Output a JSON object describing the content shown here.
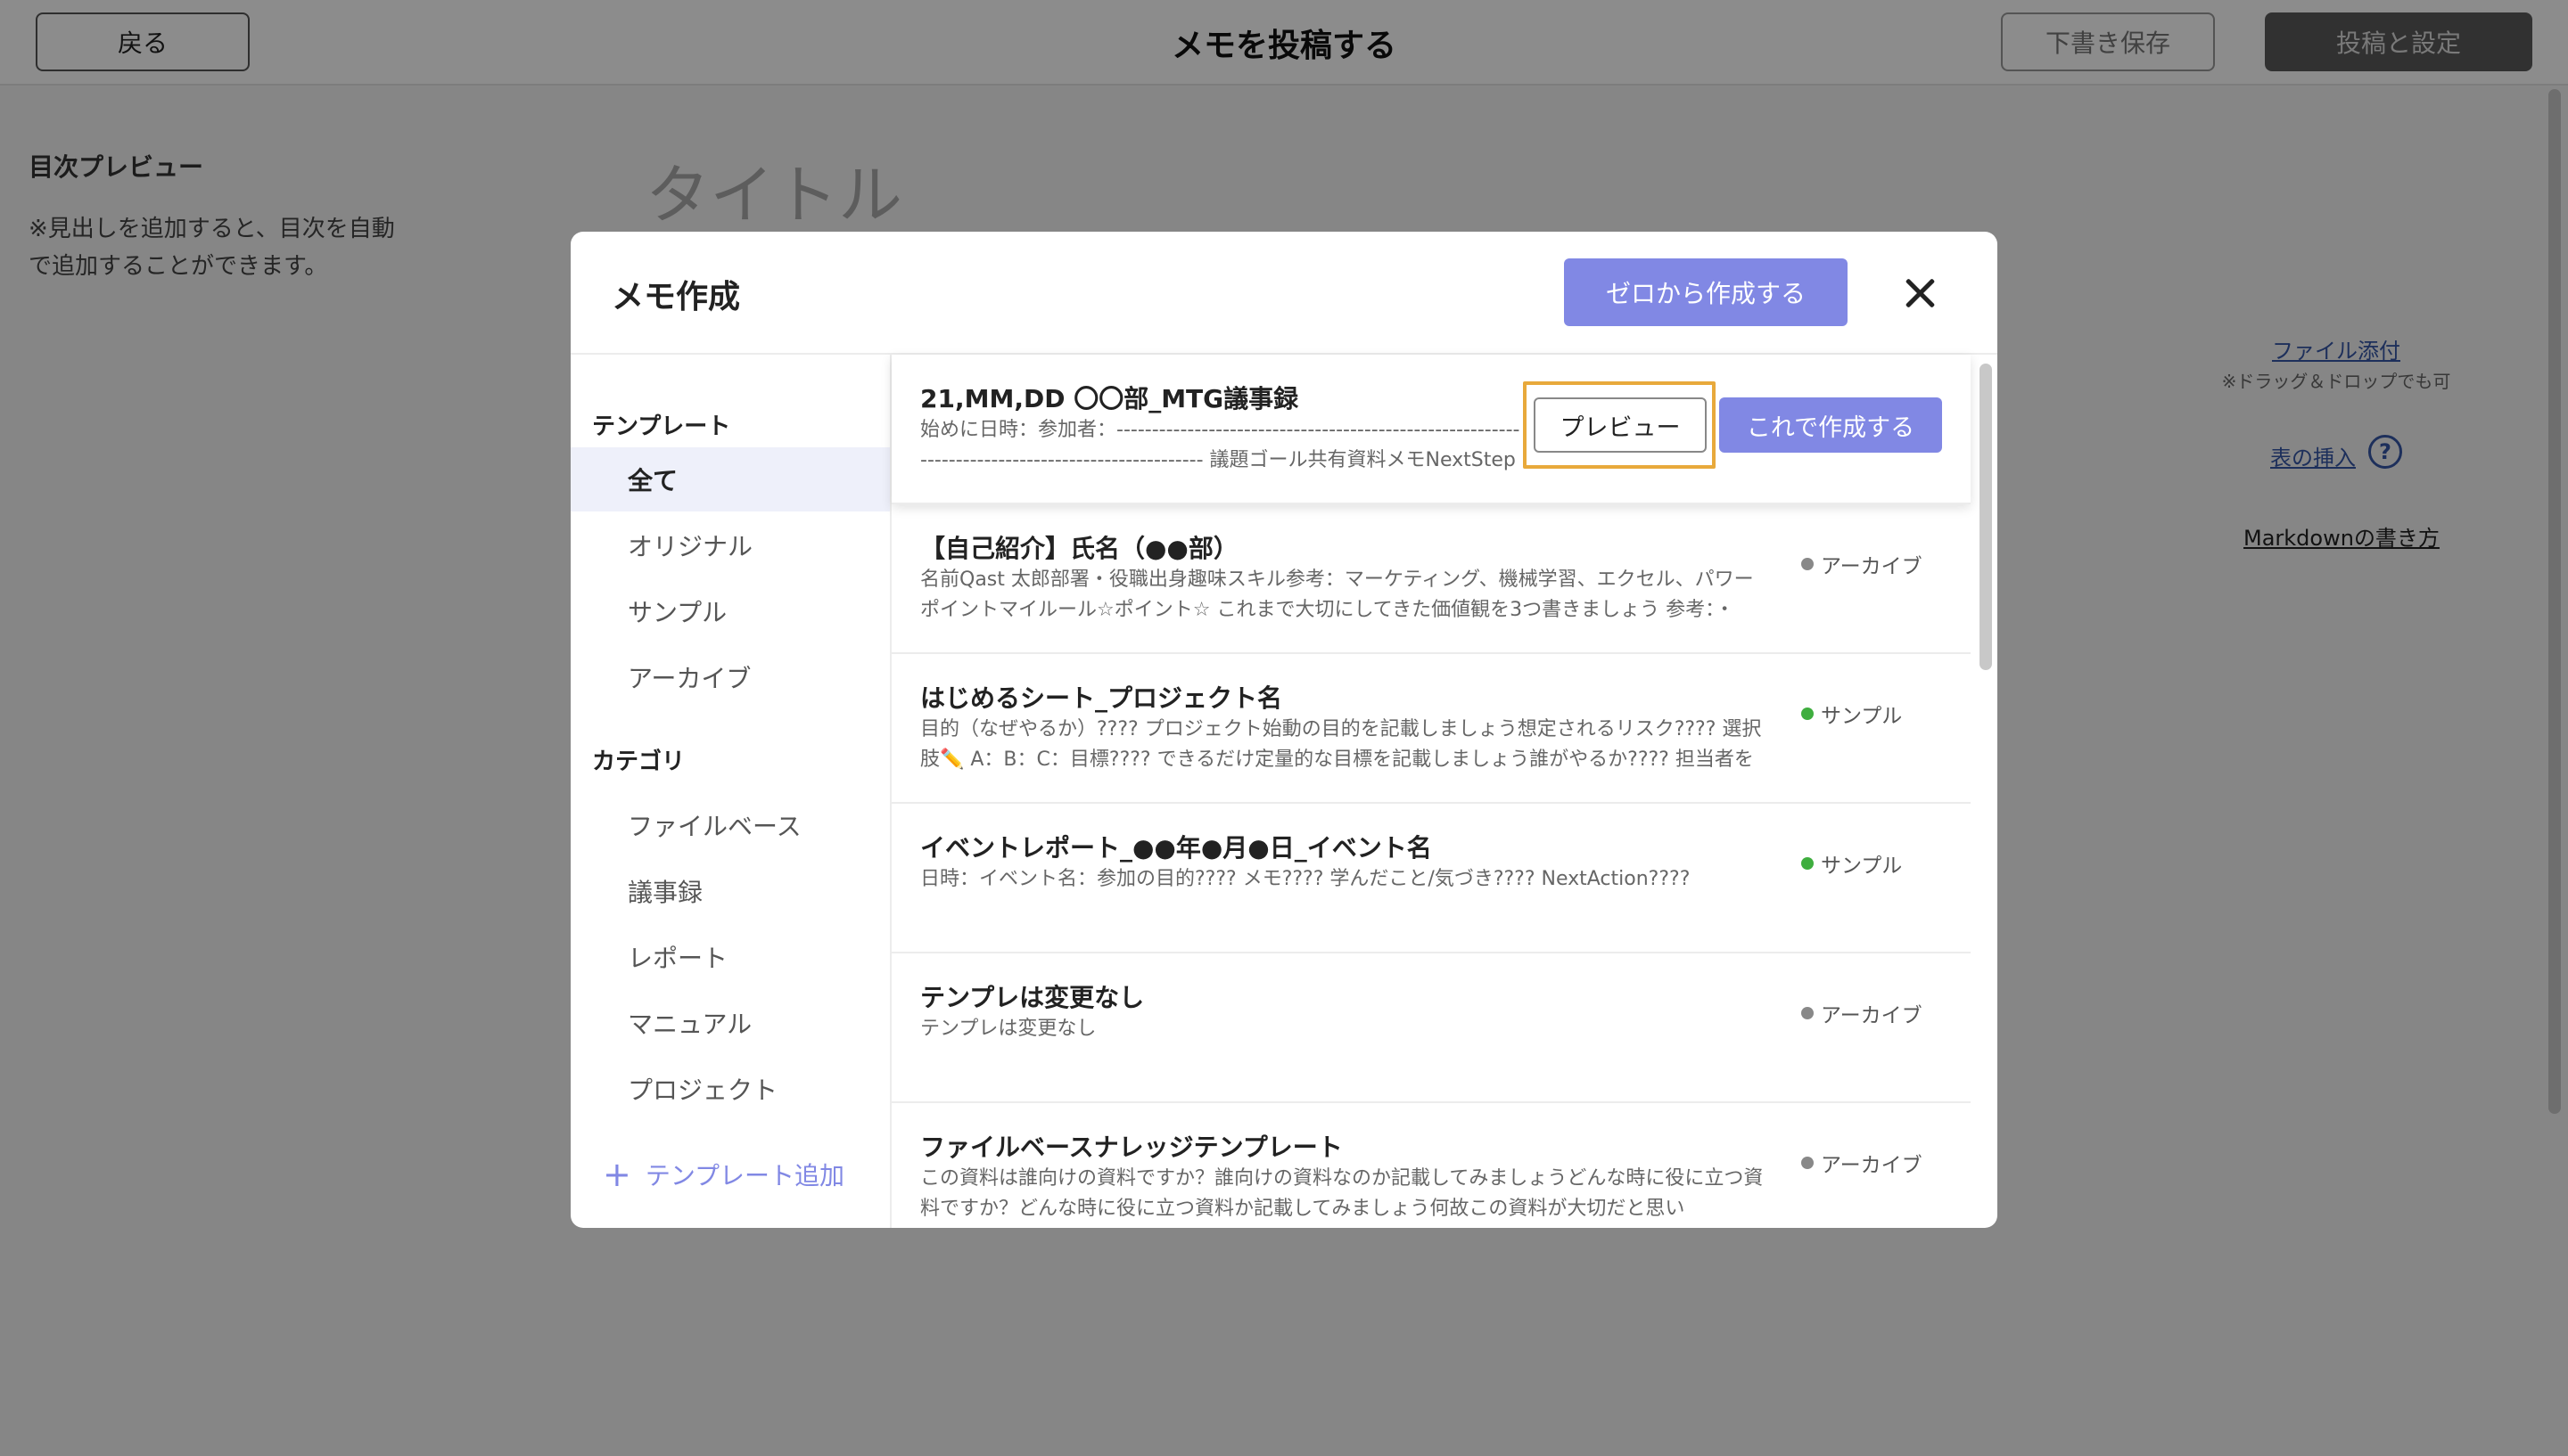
{
  "header": {
    "back_label": "戻る",
    "page_title": "メモを投稿する",
    "draft_label": "下書き保存",
    "publish_label": "投稿と設定"
  },
  "toc": {
    "title": "目次プレビュー",
    "note": "※見出しを追加すると、目次を自動で追加することができます。"
  },
  "editor": {
    "title_placeholder": "タイトル"
  },
  "right_panel": {
    "file_attach": "ファイル添付",
    "drag_note": "※ドラッグ＆ドロップでも可",
    "table_insert": "表の挿入",
    "help": "?",
    "markdown_guide": "Markdownの書き方"
  },
  "modal": {
    "title": "メモ作成",
    "create_from_scratch": "ゼロから作成する",
    "sidebar": {
      "template_heading": "テンプレート",
      "template_items": [
        "全て",
        "オリジナル",
        "サンプル",
        "アーカイブ"
      ],
      "category_heading": "カテゴリ",
      "category_items": [
        "ファイルベース",
        "議事録",
        "レポート",
        "マニュアル",
        "プロジェクト"
      ],
      "add_template": "テンプレート追加"
    },
    "preview_label": "プレビュー",
    "create_label": "これで作成する",
    "templates": [
      {
        "title": "21,MM,DD 〇〇部_MTG議事録",
        "excerpt": "始めに日時：参加者：------------------------------------------------------------------------------------------------- 議題ゴール共有資料メモNextStep",
        "tag": "",
        "tag_color": ""
      },
      {
        "title": "【自己紹介】氏名（●●部）",
        "excerpt": "名前Qast 太郎部署・役職出身趣味スキル参考：マーケティング、機械学習、エクセル、パワーポイントマイルール☆ポイント☆ これまで大切にしてきた価値観を3つ書きましょう 参考：・",
        "tag": "アーカイブ",
        "tag_color": "#888888"
      },
      {
        "title": "はじめるシート_プロジェクト名",
        "excerpt": "目的（なぜやるか）???? プロジェクト始動の目的を記載しましょう想定されるリスク???? 選択肢✏️ A：B：C：目標???? できるだけ定量的な目標を記載しましょう誰がやるか???? 担当者を",
        "tag": "サンプル",
        "tag_color": "#3fae3f"
      },
      {
        "title": "イベントレポート_●●年●月●日_イベント名",
        "excerpt": "日時：イベント名：参加の目的???? メモ???? 学んだこと/気づき???? NextAction????",
        "tag": "サンプル",
        "tag_color": "#3fae3f"
      },
      {
        "title": "テンプレは変更なし",
        "excerpt": "テンプレは変更なし",
        "tag": "アーカイブ",
        "tag_color": "#888888"
      },
      {
        "title": "ファイルベースナレッジテンプレート",
        "excerpt": "この資料は誰向けの資料ですか？誰向けの資料なのか記載してみましょうどんな時に役に立つ資料ですか？どんな時に役に立つ資料か記載してみましょう何故この資料が大切だと思い",
        "tag": "アーカイブ",
        "tag_color": "#888888"
      }
    ]
  }
}
